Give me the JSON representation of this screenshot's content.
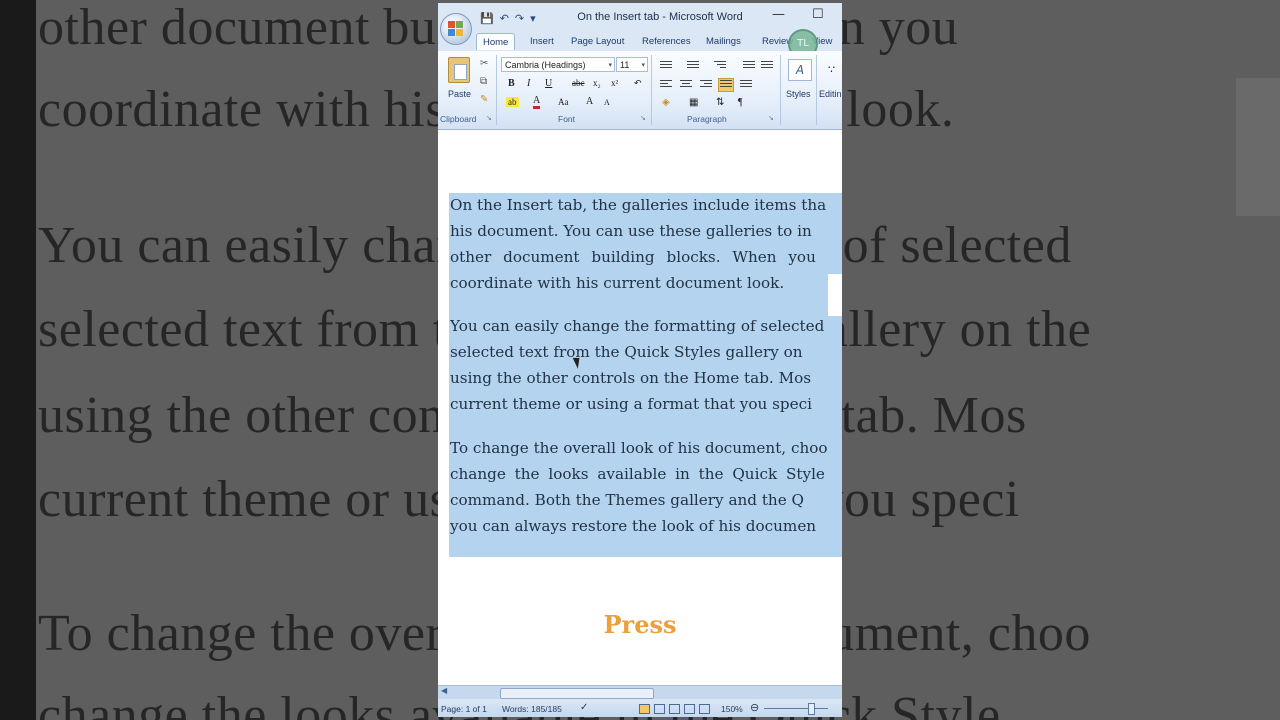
{
  "window": {
    "title": "On the Insert tab - Microsoft Word",
    "minimize_glyph": "—",
    "maximize_glyph": "☐"
  },
  "ribbon": {
    "tabs": [
      "Home",
      "Insert",
      "Page Layout",
      "References",
      "Mailings",
      "Review",
      "View"
    ],
    "active_tab": "Home",
    "font_name": "Cambria (Headings)",
    "font_size": "11",
    "paste_label": "Paste",
    "groups": {
      "clipboard": "Clipboard",
      "font": "Font",
      "paragraph": "Paragraph"
    },
    "styles_label": "Styles",
    "editing_label": "Editin",
    "badge_text": "TL"
  },
  "document": {
    "paragraphs": [
      [
        "On the Insert tab, the galleries include items tha",
        "his document. You can use these galleries to in",
        "other document building blocks. When you",
        "coordinate with his current document look."
      ],
      [
        "You can easily change the formatting of selected",
        "selected text from the Quick Styles gallery on",
        "using the other controls on the Home tab. Mos",
        "current theme or using a format that you speci"
      ],
      [
        "To change the overall look of his document, choo",
        "change the looks available in the Quick Style",
        "command. Both the Themes gallery and the Q",
        "you can always restore the look of his documen"
      ]
    ],
    "overlay_text": "Press"
  },
  "status": {
    "page": "Page: 1 of 1",
    "words": "Words: 185/185",
    "zoom": "150%"
  },
  "background": {
    "lines": [
      "other   document building blocks. When you",
      "coordinate with his current document look.",
      "You can easily change the formatting of selected",
      "selected text from the Quick Styles gallery on the",
      "using the other controls on the Home tab. Mos",
      "current theme or using a format that you speci",
      "To change the overall look of his document, choo",
      "change the looks available in the Quick Style"
    ]
  },
  "colors": {
    "selection": "#b3d3ef",
    "ribbon": "#dbe7f5",
    "press_text": "#eba039"
  }
}
